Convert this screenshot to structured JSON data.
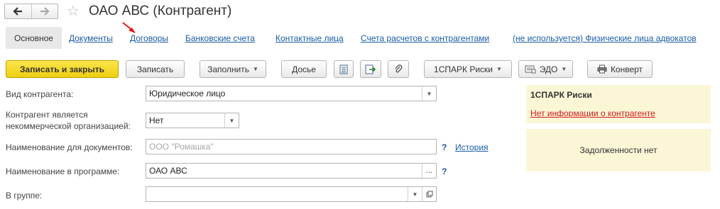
{
  "window": {
    "title": "ОАО АВС (Контрагент)",
    "back_icon": "arrow-left-icon",
    "forward_icon": "arrow-right-icon",
    "favorite_icon": "star-icon"
  },
  "tabs": {
    "active": "Основное",
    "links": [
      "Документы",
      "Договоры",
      "Банковские счета",
      "Контактные лица",
      "Счета расчетов с контрагентами",
      "(не используется) Физические лица адвокатов"
    ]
  },
  "toolbar": {
    "save_close": "Записать и закрыть",
    "save": "Записать",
    "fill": "Заполнить",
    "dossier": "Досье",
    "spark": "1СПАРК Риски",
    "edo": "ЭДО",
    "envelope": "Конверт"
  },
  "form": {
    "type": {
      "label": "Вид контрагента:",
      "value": "Юридическое лицо"
    },
    "noncommercial": {
      "label_line1": "Контрагент является",
      "label_line2": "некоммерческой организацией:",
      "value": "Нет"
    },
    "doc_name": {
      "label": "Наименование для документов:",
      "placeholder": "ООО \"Ромашка\"",
      "help": "?",
      "history": "История"
    },
    "prog_name": {
      "label": "Наименование в программе:",
      "value": "ОАО АВС",
      "help": "?",
      "select": "..."
    },
    "group": {
      "label": "В группе:",
      "value": ""
    }
  },
  "spark_panel": {
    "title": "1СПАРК Риски",
    "link": "Нет информации о контрагенте"
  },
  "debt_panel": {
    "text": "Задолженности нет"
  },
  "colors": {
    "primary_button": "#f5dc2c",
    "link": "#1a5ca6",
    "panel_bg": "#fbf6d6",
    "warning_link": "#d21a1a"
  }
}
